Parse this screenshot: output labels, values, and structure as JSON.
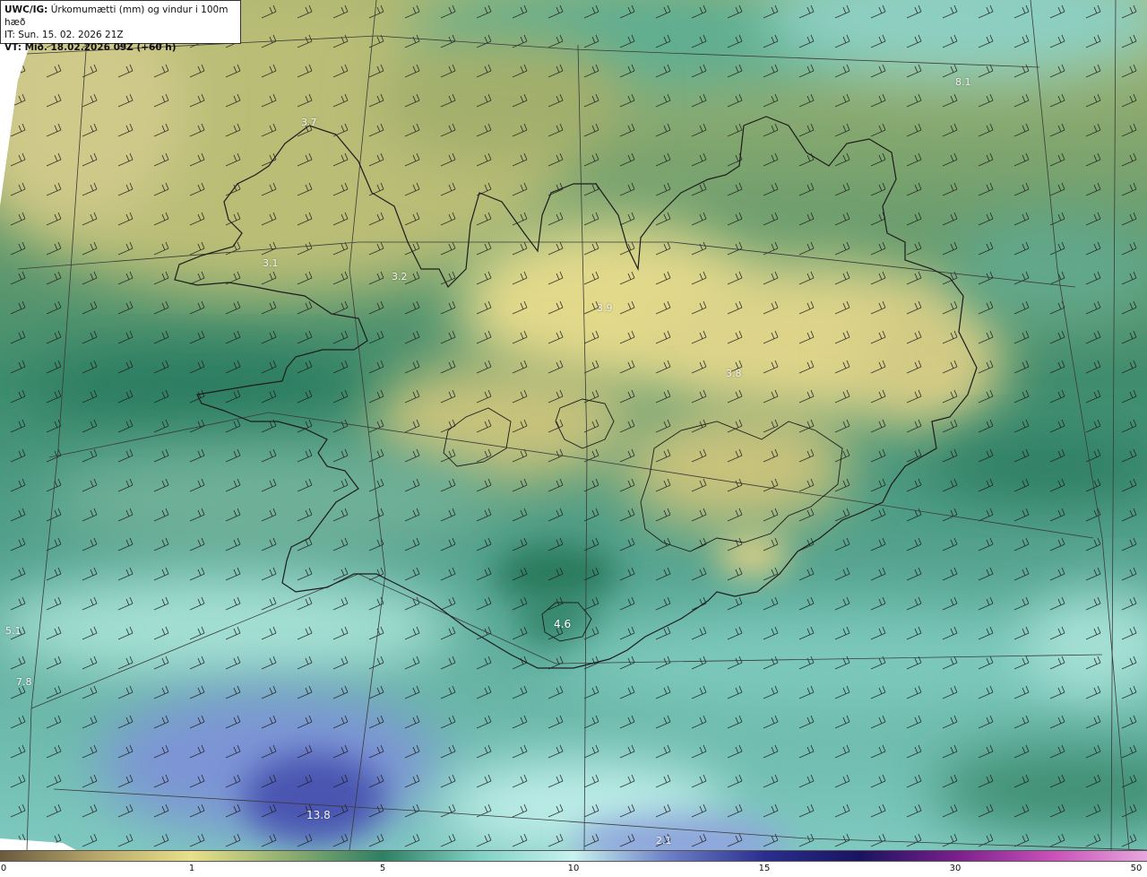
{
  "header": {
    "model": "UWC/IG:",
    "title": " Úrkomumætti (mm) og vindur i 100m hæð",
    "issue_time": "IT: Sun. 15. 02. 2026 21Z",
    "valid_prefix": "VT: ",
    "valid_time": "Mið. 18.02.2026 09Z (+60 h)"
  },
  "map_labels": [
    "3.7",
    "3.1",
    "3.2",
    "3.9",
    "3.8",
    "8.1",
    "4.6",
    "5.1",
    "7.8",
    "13.8",
    "2.1"
  ],
  "colorbar": {
    "ticks": [
      "0",
      "1",
      "5",
      "10",
      "15",
      "30",
      "50"
    ],
    "colors": [
      "#6b5a3e",
      "#b6a66a",
      "#e8e08a",
      "#8fae72",
      "#2f7f63",
      "#7fd0c4",
      "#c8f2ee",
      "#6c7fc6",
      "#2a2e8e",
      "#1a1460",
      "#7a1f8a",
      "#c850b8",
      "#e7a6dc"
    ]
  },
  "colors": {
    "land_outline": "#1c1c1c",
    "barb": "#1c1c1c",
    "grid": "#3a3a3a"
  }
}
